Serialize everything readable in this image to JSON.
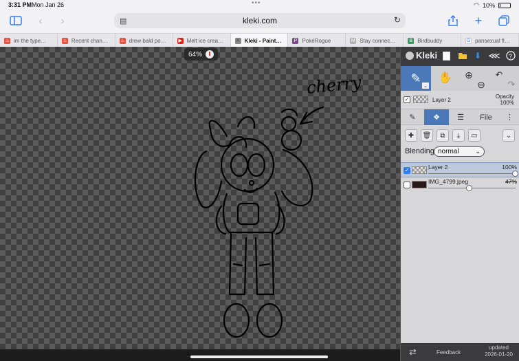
{
  "status": {
    "time": "3:31 PM",
    "date": "Mon Jan 26",
    "battery": "10%",
    "battery_level": 0.1
  },
  "browser": {
    "url": "kleki.com",
    "tabs": [
      {
        "label": "im the type…",
        "fav_color": "#e8513b",
        "fav_glyph": "♨"
      },
      {
        "label": "Recent chan…",
        "fav_color": "#e8513b",
        "fav_glyph": "♨"
      },
      {
        "label": "drew bald po…",
        "fav_color": "#e8513b",
        "fav_glyph": "♨"
      },
      {
        "label": "Melt ice crea…",
        "fav_color": "#e62117",
        "fav_glyph": "▶"
      },
      {
        "label": "Kleki - Paint…",
        "fav_color": "#888888",
        "fav_glyph": "✕"
      },
      {
        "label": "PokéRogue",
        "fav_color": "#7a4a8c",
        "fav_glyph": "P"
      },
      {
        "label": "Stay connec…",
        "fav_color": "#b0b0b0",
        "fav_glyph": "M"
      },
      {
        "label": "Birdbuddy",
        "fav_color": "#2f9c5a",
        "fav_glyph": "B"
      },
      {
        "label": "pansexual fl…",
        "fav_color": "#ffffff",
        "fav_glyph": "G"
      }
    ],
    "active_tab_index": 4
  },
  "canvas": {
    "zoom": "64%",
    "annotation": "cherry"
  },
  "kleki": {
    "logo": "Kleki",
    "current_layer": "Layer 2",
    "opacity_label": "Opacity",
    "opacity_value": "100%",
    "file_tab": "File",
    "blending_label": "Blending",
    "blending_mode": "normal",
    "layers": [
      {
        "name": "Layer 2",
        "opacity": "100%",
        "opacity_level": 1.0,
        "checked": true,
        "selected": true
      },
      {
        "name": "IMG_4799.jpeg",
        "opacity": "47%",
        "opacity_level": 0.47,
        "checked": false,
        "selected": false
      }
    ],
    "footer": {
      "feedback": "Feedback",
      "updated_label": "updated",
      "updated_date": "2026-01-20"
    }
  }
}
